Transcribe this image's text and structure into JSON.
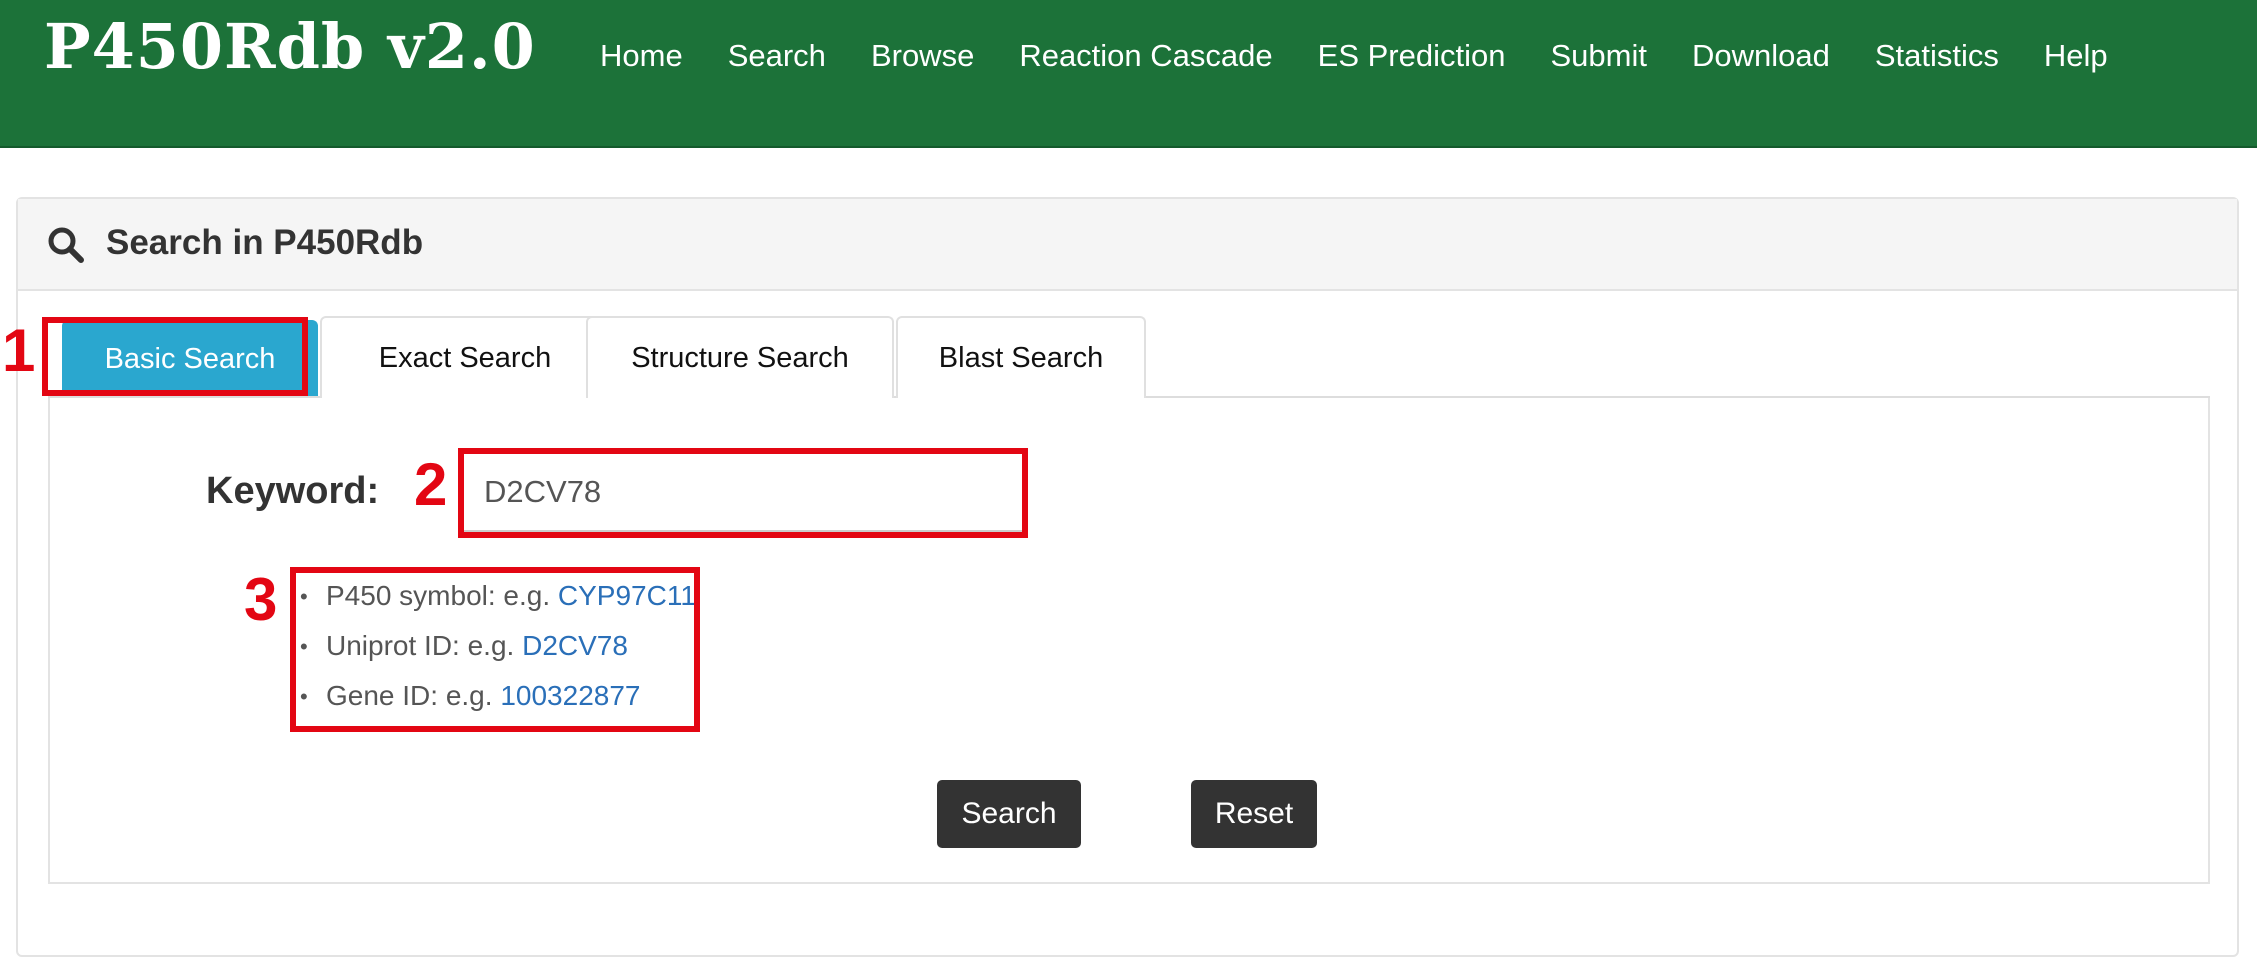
{
  "navbar": {
    "brand": "P450Rdb v2.0",
    "links": [
      "Home",
      "Search",
      "Browse",
      "Reaction Cascade",
      "ES Prediction",
      "Submit",
      "Download",
      "Statistics",
      "Help"
    ]
  },
  "panel": {
    "title": "Search in P450Rdb",
    "icon": "search-icon"
  },
  "tabs": [
    {
      "label": "Basic Search",
      "active": true
    },
    {
      "label": "Exact Search",
      "active": false
    },
    {
      "label": "Structure Search",
      "active": false
    },
    {
      "label": "Blast Search",
      "active": false
    }
  ],
  "form": {
    "keyword_label": "Keyword:",
    "keyword_value": "D2CV78",
    "examples": [
      {
        "prefix": "P450 symbol: e.g. ",
        "link": "CYP97C11"
      },
      {
        "prefix": "Uniprot ID: e.g. ",
        "link": "D2CV78"
      },
      {
        "prefix": "Gene ID: e.g. ",
        "link": "100322877"
      }
    ],
    "search_button": "Search",
    "reset_button": "Reset"
  },
  "annotations": [
    "1",
    "2",
    "3"
  ],
  "colors": {
    "navbar": "#1c7239",
    "active_tab": "#2aa7cf",
    "link": "#2a6fb8",
    "button": "#333333",
    "annotation": "#e30613"
  }
}
